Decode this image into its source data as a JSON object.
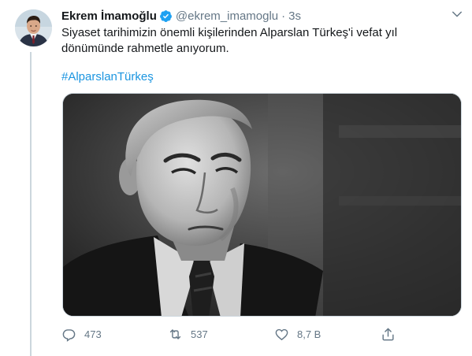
{
  "tweet": {
    "author_name": "Ekrem İmamoğlu",
    "handle": "@ekrem_imamoglu",
    "separator": "·",
    "time": "3s",
    "text": "Siyaset tarihimizin önemli kişilerinden Alparslan Türkeş'i vefat yıl dönümünde rahmetle anıyorum.",
    "hashtag": "#AlparslanTürkeş",
    "actions": {
      "reply_count": "473",
      "retweet_count": "537",
      "like_count": "8,7 B"
    }
  },
  "colors": {
    "link": "#1b95e0",
    "verified": "#1da1f2",
    "secondary_text": "#657786"
  },
  "icons": {
    "verified": "verified-badge-icon",
    "caret": "chevron-down-icon",
    "reply": "reply-icon",
    "retweet": "retweet-icon",
    "like": "heart-icon",
    "share": "share-icon"
  }
}
